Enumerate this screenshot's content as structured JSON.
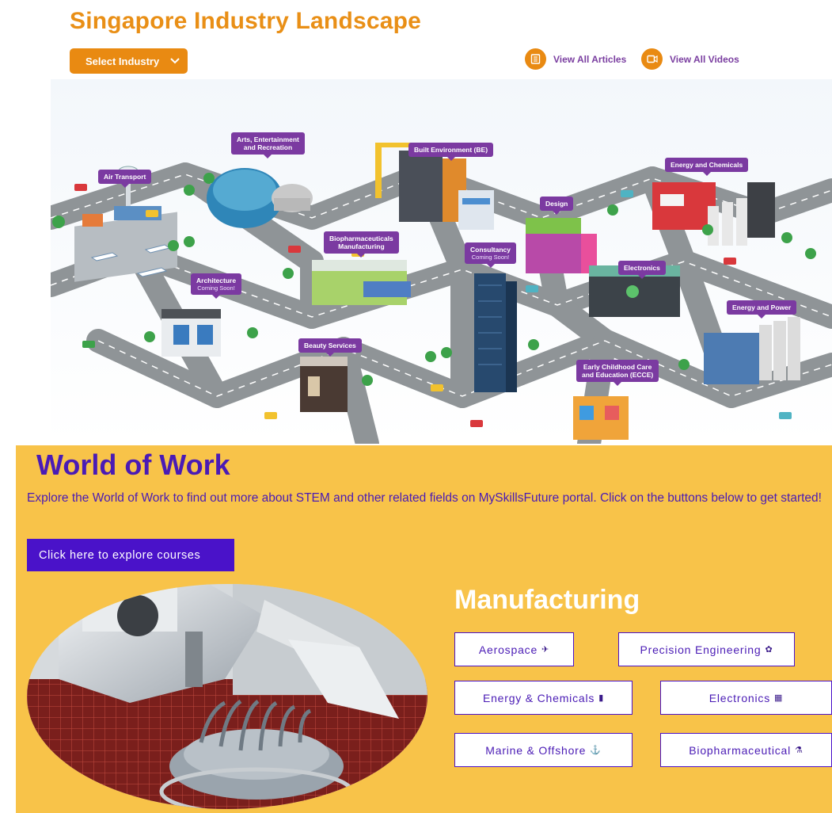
{
  "landscape": {
    "title": "Singapore Industry Landscape",
    "select_label": "Select Industry",
    "articles_label": "View All Articles",
    "videos_label": "View All Videos",
    "pins": {
      "arts": {
        "line1": "Arts, Entertainment",
        "line2": "and Recreation"
      },
      "air": {
        "line1": "Air Transport"
      },
      "be": {
        "line1": "Built Environment (BE)"
      },
      "energy_chem": {
        "line1": "Energy and Chemicals"
      },
      "design": {
        "line1": "Design"
      },
      "bio": {
        "line1": "Biopharmaceuticals",
        "line2": "Manufacturing"
      },
      "consult": {
        "line1": "Consultancy",
        "soon": "Coming Soon!"
      },
      "electronics": {
        "line1": "Electronics"
      },
      "arch": {
        "line1": "Architecture",
        "soon": "Coming Soon!"
      },
      "energy_power": {
        "line1": "Energy and Power"
      },
      "beauty": {
        "line1": "Beauty Services"
      },
      "ecce": {
        "line1": "Early Childhood Care",
        "line2": "and Education (ECCE)"
      }
    }
  },
  "wow": {
    "title": "World of Work",
    "description": "Explore the World of Work to find out more about STEM and other related fields on MySkillsFuture portal. Click on the buttons below to get started!",
    "explore_button": "Click here to explore courses",
    "manufacturing_title": "Manufacturing",
    "buttons": [
      {
        "label": "Aerospace",
        "icon": "✈"
      },
      {
        "label": "Precision Engineering",
        "icon": "✿"
      },
      {
        "label": "Energy & Chemicals",
        "icon": "▮"
      },
      {
        "label": "Electronics",
        "icon": "▦"
      },
      {
        "label": "Marine & Offshore",
        "icon": "⚓"
      },
      {
        "label": "Biopharmaceutical",
        "icon": "⚗"
      }
    ]
  },
  "colors": {
    "orange": "#e98a12",
    "purple_pin": "#7b3aa1",
    "wow_bg": "#f8c349",
    "indigo": "#4a12c9"
  }
}
